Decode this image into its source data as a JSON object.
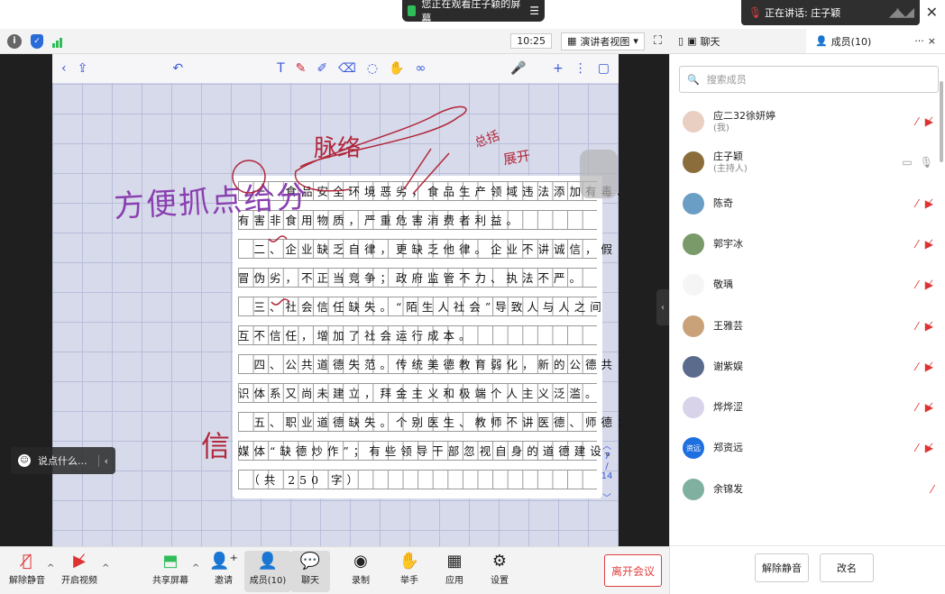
{
  "banner": {
    "sharing_text": "您正在观看庄子颖的屏幕",
    "menu_icon": "menu-icon"
  },
  "speaking": {
    "label": "正在讲话: 庄子颖"
  },
  "topbar": {
    "time": "10:25",
    "view_label": "演讲者视图"
  },
  "panel_tabs": {
    "chat": "聊天",
    "members": "成员(10)",
    "more": "···",
    "close": "×"
  },
  "notes": {
    "lines": [
      "　一、食品安全环境恶劣，食品生产领域违法添加有毒、",
      "有害非食用物质，严重危害消费者利益。",
      "　二、企业缺乏自律，更缺乏他律。企业不讲诚信，假",
      "冒伪劣，不正当竞争；政府监管不力、执法不严。",
      "　三、社会信任缺失。“陌生人社会”导致人与人之间",
      "互不信任，增加了社会运行成本。",
      "　四、公共道德失范。传统美德教育弱化，新的公德共",
      "识体系又尚未建立，拜金主义和极端个人主义泛滥。",
      "　五、职业道德缺失。个别医生、教师不讲医德、师德；",
      "媒体“缺德炒作”；有些领导干部忽视自身的道德建设。",
      "　（共 250 字）"
    ],
    "page_current": "7",
    "page_total": "14",
    "handwriting_left": "方便抓点给分",
    "handwriting_top": "脉络",
    "handwriting_small1": "总括",
    "handwriting_small2": "展开",
    "handwriting_xin": "信"
  },
  "chat_float": {
    "placeholder": "说点什么..."
  },
  "bottombar": {
    "unmute": "解除静音",
    "video": "开启视频",
    "share": "共享屏幕",
    "invite": "邀请",
    "members": "成员(10)",
    "chat": "聊天",
    "record": "录制",
    "raise_hand": "举手",
    "apps": "应用",
    "settings": "设置",
    "leave": "离开会议"
  },
  "panel": {
    "search_placeholder": "搜索成员",
    "members": [
      {
        "name": "应二32徐妍婷",
        "role": "(我)"
      },
      {
        "name": "庄子颖",
        "role": "(主持人)"
      },
      {
        "name": "陈奇",
        "role": ""
      },
      {
        "name": "郭宇冰",
        "role": ""
      },
      {
        "name": "敬瑀",
        "role": ""
      },
      {
        "name": "王雅芸",
        "role": ""
      },
      {
        "name": "谢紫娱",
        "role": ""
      },
      {
        "name": "烨烨涩",
        "role": ""
      },
      {
        "name": "郑资远",
        "role": "",
        "avatar_text": "资远"
      },
      {
        "name": "余锦发",
        "role": ""
      }
    ],
    "unmute_all": "解除静音",
    "rename": "改名"
  },
  "colors": {
    "accent": "#3a5ad8",
    "danger": "#e04040",
    "ink_red": "#b1263a",
    "ink_purple": "#8a3fb0"
  }
}
